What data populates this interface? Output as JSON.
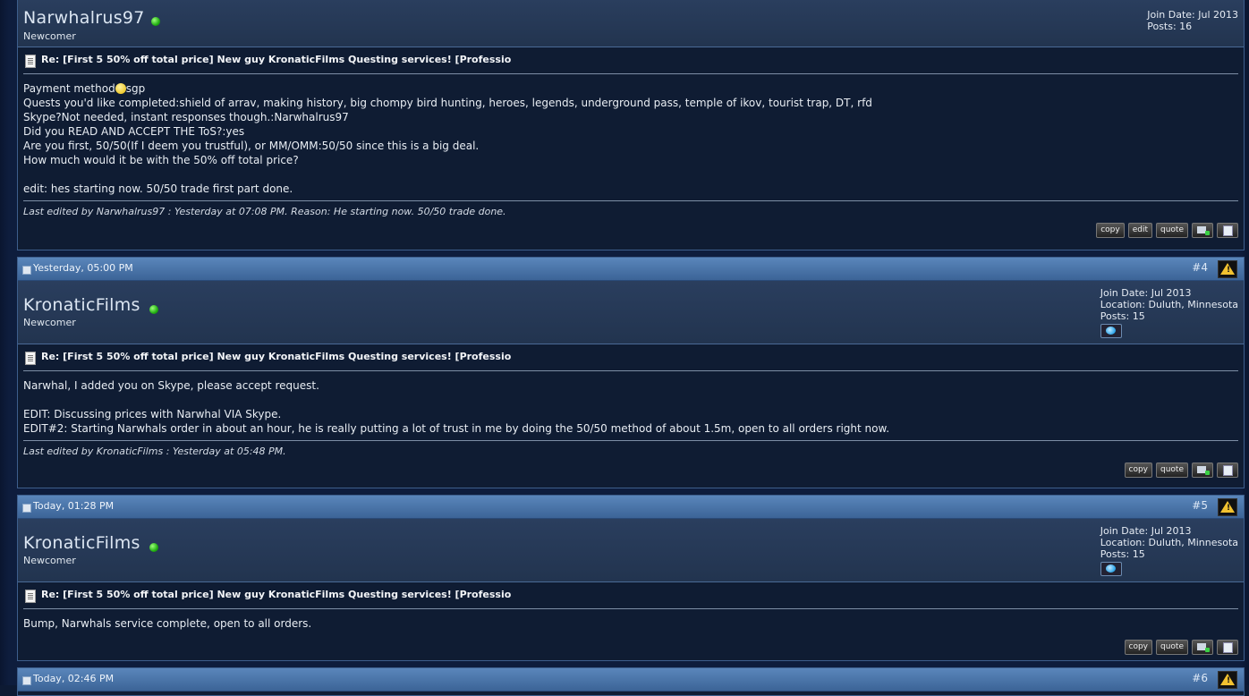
{
  "posts": [
    {
      "username": "Narwhalrus97",
      "rank": "Newcomer",
      "info": [
        "Join Date: Jul 2013",
        "Posts: 16"
      ],
      "title": "Re: [First 5 50% off total price] New guy KronaticFilms Questing services! [Professio",
      "content_before_smiley": "Payment method",
      "content_after_smiley": "sgp",
      "content_lines": [
        "Quests you'd like completed:shield of arrav, making history, big chompy bird hunting, heroes, legends, underground pass, temple of ikov, tourist trap, DT, rfd",
        "Skype?Not needed, instant responses though.:Narwhalrus97",
        "Did you READ AND ACCEPT THE ToS?:yes",
        "Are you first, 50/50(If I deem you trustful), or MM/OMM:50/50 since this is a big deal.",
        "How much would it be with the 50% off total price?",
        "",
        "edit: hes starting now. 50/50 trade first part done."
      ],
      "edited": "Last edited by Narwhalrus97 : Yesterday at 07:08 PM. Reason: He starting now. 50/50 trade done.",
      "buttons": [
        "copy",
        "edit",
        "quote"
      ]
    },
    {
      "date": "Yesterday, 05:00 PM",
      "number": "#4",
      "username": "KronaticFilms",
      "rank": "Newcomer",
      "info": [
        "Join Date: Jul 2013",
        "Location: Duluth, Minnesota",
        "Posts: 15"
      ],
      "title": "Re: [First 5 50% off total price] New guy KronaticFilms Questing services! [Professio",
      "content": "Narwhal, I added you on Skype, please accept request.\n\nEDIT: Discussing prices with Narwhal VIA Skype.\nEDIT#2: Starting Narwhals order in about an hour, he is really putting a lot of trust in me by doing the 50/50 method of about 1.5m, open to all orders right now.",
      "edited": "Last edited by KronaticFilms : Yesterday at 05:48 PM.",
      "buttons": [
        "copy",
        "quote"
      ]
    },
    {
      "date": "Today, 01:28 PM",
      "number": "#5",
      "username": "KronaticFilms",
      "rank": "Newcomer",
      "info": [
        "Join Date: Jul 2013",
        "Location: Duluth, Minnesota",
        "Posts: 15"
      ],
      "title": "Re: [First 5 50% off total price] New guy KronaticFilms Questing services! [Professio",
      "content": "Bump, Narwhals service complete, open to all orders.",
      "buttons": [
        "copy",
        "quote"
      ]
    },
    {
      "date": "Today, 02:46 PM",
      "number": "#6"
    }
  ],
  "icons": {
    "online": "online-status-icon",
    "report": "report-warning-icon",
    "post_doc": "post-document-icon",
    "skype": "skype-icon",
    "multiquote": "multiquote-icon",
    "quick_edit": "quick-reply-icon",
    "smiley": "smiley-icon"
  },
  "colors": {
    "background": "#0e1d3d",
    "header": "#4a74a8",
    "online": "#22b012"
  }
}
